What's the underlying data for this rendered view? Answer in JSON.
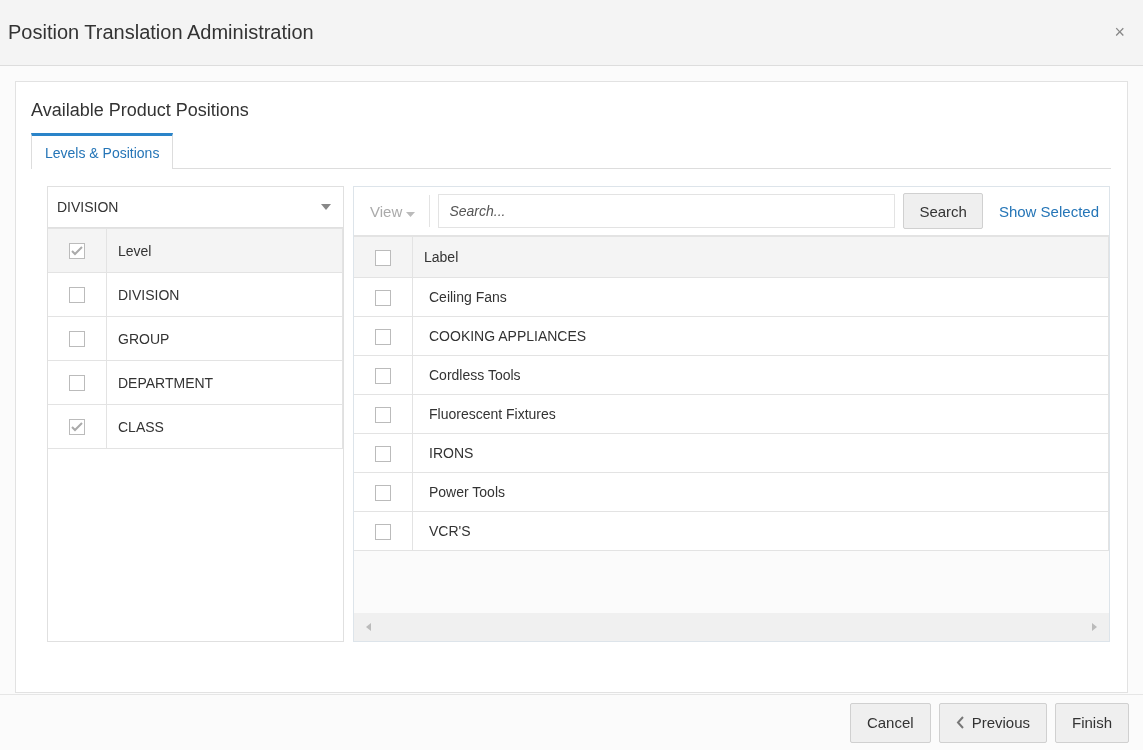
{
  "window": {
    "title": "Position Translation Administration",
    "close": "×"
  },
  "section_title": "Available Product Positions",
  "tabs": [
    {
      "label": "Levels & Positions",
      "selected": true
    }
  ],
  "level_select": {
    "value": "DIVISION"
  },
  "levels_table": {
    "header": {
      "label": "Level",
      "checked": true
    },
    "rows": [
      {
        "label": "DIVISION",
        "checked": false
      },
      {
        "label": "GROUP",
        "checked": false
      },
      {
        "label": "DEPARTMENT",
        "checked": false
      },
      {
        "label": "CLASS",
        "checked": true
      }
    ]
  },
  "toolbar": {
    "view_menu": "View",
    "search": {
      "placeholder": "Search..."
    },
    "search_button": "Search",
    "show_selected": "Show Selected"
  },
  "positions_table": {
    "header": {
      "label": "Label",
      "checked": false
    },
    "rows": [
      {
        "label": "Ceiling Fans",
        "checked": false
      },
      {
        "label": "COOKING APPLIANCES",
        "checked": false
      },
      {
        "label": "Cordless Tools",
        "checked": false
      },
      {
        "label": "Fluorescent Fixtures",
        "checked": false
      },
      {
        "label": "IRONS",
        "checked": false
      },
      {
        "label": "Power Tools",
        "checked": false
      },
      {
        "label": "VCR'S",
        "checked": false
      }
    ]
  },
  "buttons": [
    {
      "label": "Cancel",
      "kind": "plain"
    },
    {
      "label": "Previous",
      "kind": "back"
    },
    {
      "label": "Finish",
      "kind": "plain"
    }
  ]
}
